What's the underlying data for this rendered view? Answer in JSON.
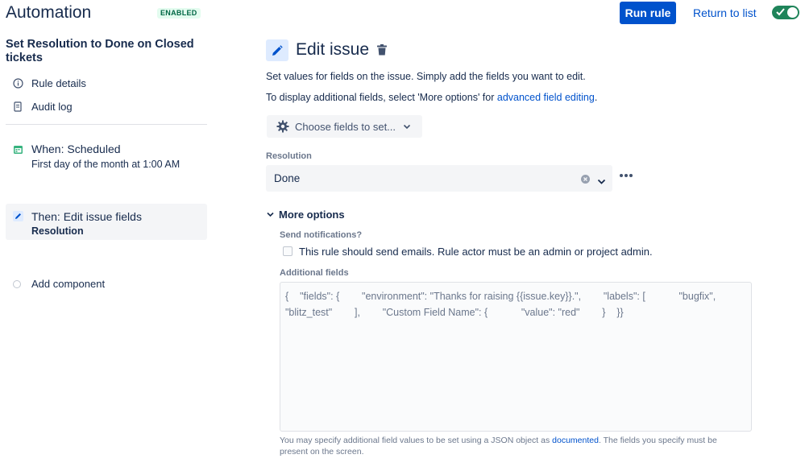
{
  "header": {
    "app_title": "Automation",
    "status_badge": "ENABLED",
    "run_rule_label": "Run rule",
    "return_label": "Return to list",
    "rule_enabled": true,
    "accent_color": "#0052cc",
    "toggle_color": "#1f845a"
  },
  "sidebar": {
    "rule_name": "Set Resolution to Done on Closed tickets",
    "links": [
      {
        "label": "Rule details",
        "icon": "info-icon"
      },
      {
        "label": "Audit log",
        "icon": "document-icon"
      }
    ],
    "steps": [
      {
        "title": "When: Scheduled",
        "subtitle": "First day of the month at 1:00 AM",
        "icon": "calendar-icon"
      },
      {
        "title": "Then: Edit issue fields",
        "subtitle": "Resolution",
        "icon": "pencil-icon",
        "active": true
      }
    ],
    "add_component_label": "Add component"
  },
  "main": {
    "title": "Edit issue",
    "description": "Set values for fields on the issue. Simply add the fields you want to edit.",
    "more_info_prefix": "To display additional fields, select 'More options' for ",
    "more_info_link": "advanced field editing",
    "more_info_suffix": ".",
    "choose_fields_label": "Choose fields to set...",
    "resolution_label": "Resolution",
    "resolution_value": "Done",
    "more_options_label": "More options",
    "send_notifications_label": "Send notifications?",
    "send_notifications_text": "This rule should send emails. Rule actor must be an admin or project admin.",
    "send_notifications_checked": false,
    "additional_fields_label": "Additional fields",
    "additional_fields_value": "{    \"fields\": {        \"environment\": \"Thanks for raising {{issue.key}}.\",        \"labels\": [            \"bugfix\", \"blitz_test\"        ],        \"Custom Field Name\": {            \"value\": \"red\"        }    }}",
    "help_prefix": "You may specify additional field values to be set using a JSON object as ",
    "help_link": "documented",
    "help_suffix": ". The fields you specify must be present on the screen."
  }
}
